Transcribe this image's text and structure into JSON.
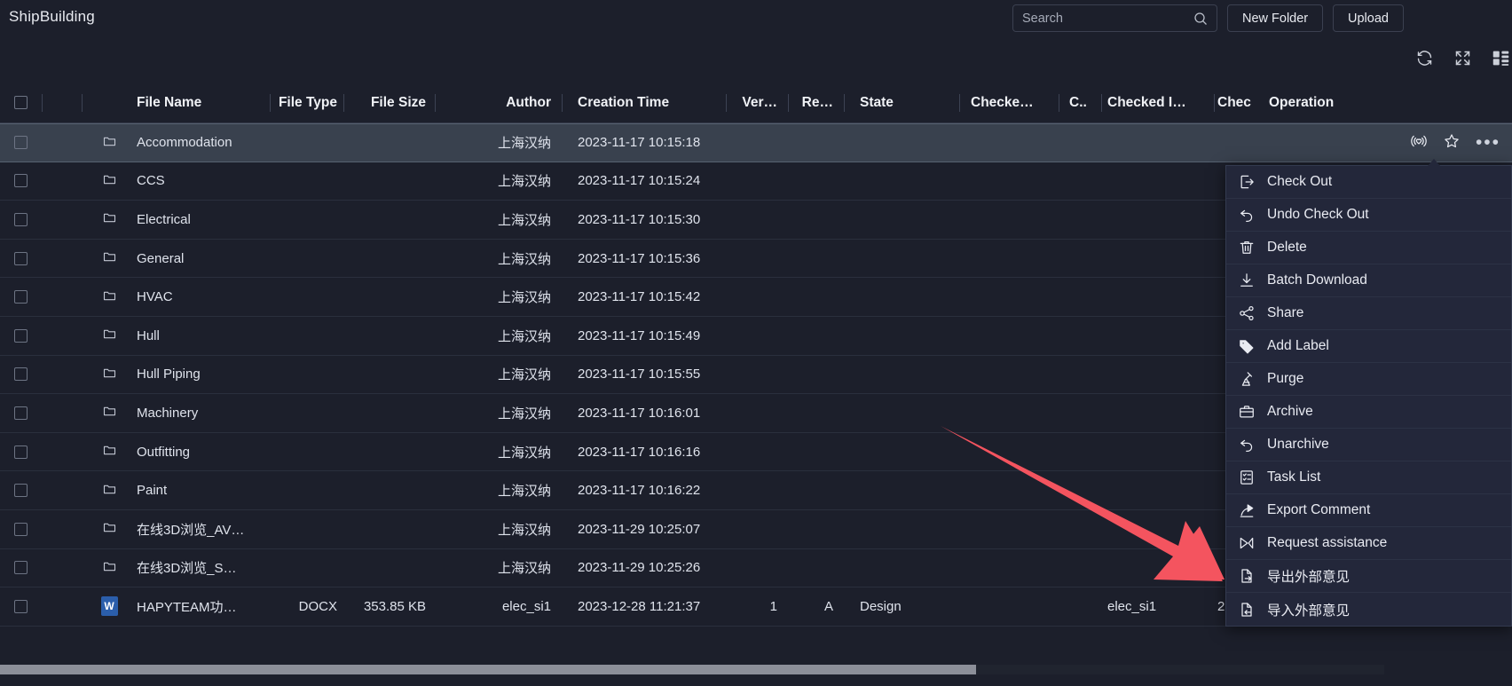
{
  "app": {
    "breadcrumb": "ShipBuilding",
    "accent_color": "#2b5eab",
    "arrow_color": "#f4545f",
    "background_color": "#1c1f2b",
    "selected_row_color": "#39414e"
  },
  "header": {
    "search": {
      "placeholder": "Search",
      "value": "",
      "icon": "search-icon"
    },
    "new_folder_label": "New Folder",
    "upload_label": "Upload",
    "tool_icons": [
      "refresh-icon",
      "fullscreen-icon",
      "layout-columns-icon"
    ]
  },
  "table": {
    "columns": [
      {
        "key": "check",
        "label": ""
      },
      {
        "key": "fav",
        "label": ""
      },
      {
        "key": "icon",
        "label": ""
      },
      {
        "key": "name",
        "label": "File Name"
      },
      {
        "key": "type",
        "label": "File Type"
      },
      {
        "key": "size",
        "label": "File Size"
      },
      {
        "key": "author",
        "label": "Author"
      },
      {
        "key": "created",
        "label": "Creation Time"
      },
      {
        "key": "version",
        "label": "Ver…"
      },
      {
        "key": "revision",
        "label": "Re…"
      },
      {
        "key": "state",
        "label": "State"
      },
      {
        "key": "checked_by",
        "label": "Checke…"
      },
      {
        "key": "c",
        "label": "C.."
      },
      {
        "key": "checked_in",
        "label": "Checked I…"
      },
      {
        "key": "checked_d",
        "label": "Chec"
      },
      {
        "key": "operation",
        "label": "Operation"
      }
    ],
    "rows": [
      {
        "selected": true,
        "icon": "folder-icon",
        "name": "Accommodation",
        "type": "",
        "size": "",
        "author": "上海汉纳",
        "created": "2023-11-17 10:15:18",
        "version": "",
        "revision": "",
        "state": "",
        "checked_by": "",
        "c": "",
        "checked_in": "",
        "checked_d": ""
      },
      {
        "selected": false,
        "icon": "folder-icon",
        "name": "CCS",
        "type": "",
        "size": "",
        "author": "上海汉纳",
        "created": "2023-11-17 10:15:24",
        "version": "",
        "revision": "",
        "state": "",
        "checked_by": "",
        "c": "",
        "checked_in": "",
        "checked_d": ""
      },
      {
        "selected": false,
        "icon": "folder-icon",
        "name": "Electrical",
        "type": "",
        "size": "",
        "author": "上海汉纳",
        "created": "2023-11-17 10:15:30",
        "version": "",
        "revision": "",
        "state": "",
        "checked_by": "",
        "c": "",
        "checked_in": "",
        "checked_d": ""
      },
      {
        "selected": false,
        "icon": "folder-icon",
        "name": "General",
        "type": "",
        "size": "",
        "author": "上海汉纳",
        "created": "2023-11-17 10:15:36",
        "version": "",
        "revision": "",
        "state": "",
        "checked_by": "",
        "c": "",
        "checked_in": "",
        "checked_d": ""
      },
      {
        "selected": false,
        "icon": "folder-icon",
        "name": "HVAC",
        "type": "",
        "size": "",
        "author": "上海汉纳",
        "created": "2023-11-17 10:15:42",
        "version": "",
        "revision": "",
        "state": "",
        "checked_by": "",
        "c": "",
        "checked_in": "",
        "checked_d": ""
      },
      {
        "selected": false,
        "icon": "folder-icon",
        "name": "Hull",
        "type": "",
        "size": "",
        "author": "上海汉纳",
        "created": "2023-11-17 10:15:49",
        "version": "",
        "revision": "",
        "state": "",
        "checked_by": "",
        "c": "",
        "checked_in": "",
        "checked_d": ""
      },
      {
        "selected": false,
        "icon": "folder-icon",
        "name": "Hull Piping",
        "type": "",
        "size": "",
        "author": "上海汉纳",
        "created": "2023-11-17 10:15:55",
        "version": "",
        "revision": "",
        "state": "",
        "checked_by": "",
        "c": "",
        "checked_in": "",
        "checked_d": ""
      },
      {
        "selected": false,
        "icon": "folder-icon",
        "name": "Machinery",
        "type": "",
        "size": "",
        "author": "上海汉纳",
        "created": "2023-11-17 10:16:01",
        "version": "",
        "revision": "",
        "state": "",
        "checked_by": "",
        "c": "",
        "checked_in": "",
        "checked_d": ""
      },
      {
        "selected": false,
        "icon": "folder-icon",
        "name": "Outfitting",
        "type": "",
        "size": "",
        "author": "上海汉纳",
        "created": "2023-11-17 10:16:16",
        "version": "",
        "revision": "",
        "state": "",
        "checked_by": "",
        "c": "",
        "checked_in": "",
        "checked_d": ""
      },
      {
        "selected": false,
        "icon": "folder-icon",
        "name": "Paint",
        "type": "",
        "size": "",
        "author": "上海汉纳",
        "created": "2023-11-17 10:16:22",
        "version": "",
        "revision": "",
        "state": "",
        "checked_by": "",
        "c": "",
        "checked_in": "",
        "checked_d": ""
      },
      {
        "selected": false,
        "icon": "folder-icon",
        "name": "在线3D浏览_AV…",
        "type": "",
        "size": "",
        "author": "上海汉纳",
        "created": "2023-11-29 10:25:07",
        "version": "",
        "revision": "",
        "state": "",
        "checked_by": "",
        "c": "",
        "checked_in": "",
        "checked_d": ""
      },
      {
        "selected": false,
        "icon": "folder-icon",
        "name": "在线3D浏览_S…",
        "type": "",
        "size": "",
        "author": "上海汉纳",
        "created": "2023-11-29 10:25:26",
        "version": "",
        "revision": "",
        "state": "",
        "checked_by": "",
        "c": "",
        "checked_in": "",
        "checked_d": ""
      },
      {
        "selected": false,
        "icon": "word-icon",
        "name": "HAPYTEAM功…",
        "type": "DOCX",
        "size": "353.85 KB",
        "author": "elec_si1",
        "created": "2023-12-28 11:21:37",
        "version": "1",
        "revision": "A",
        "state": "Design",
        "checked_by": "",
        "c": "",
        "checked_in": "elec_si1",
        "checked_d": "2"
      }
    ],
    "row_operations": [
      "broadcast-heart-icon",
      "star-icon",
      "more-dots-icon"
    ]
  },
  "context_menu": {
    "items": [
      {
        "label": "Check Out",
        "icon": "check-out-icon"
      },
      {
        "label": "Undo Check Out",
        "icon": "undo-icon"
      },
      {
        "label": "Delete",
        "icon": "trash-icon"
      },
      {
        "label": "Batch Download",
        "icon": "download-icon"
      },
      {
        "label": "Share",
        "icon": "share-icon"
      },
      {
        "label": "Add Label",
        "icon": "tag-icon"
      },
      {
        "label": "Purge",
        "icon": "broom-icon"
      },
      {
        "label": "Archive",
        "icon": "briefcase-icon"
      },
      {
        "label": "Unarchive",
        "icon": "undo-icon"
      },
      {
        "label": "Task List",
        "icon": "task-list-icon"
      },
      {
        "label": "Export Comment",
        "icon": "export-arrow-icon"
      },
      {
        "label": "Request assistance",
        "icon": "request-assistance-icon"
      },
      {
        "label": "导出外部意见",
        "icon": "file-export-icon"
      },
      {
        "label": "导入外部意见",
        "icon": "file-import-icon"
      }
    ]
  }
}
